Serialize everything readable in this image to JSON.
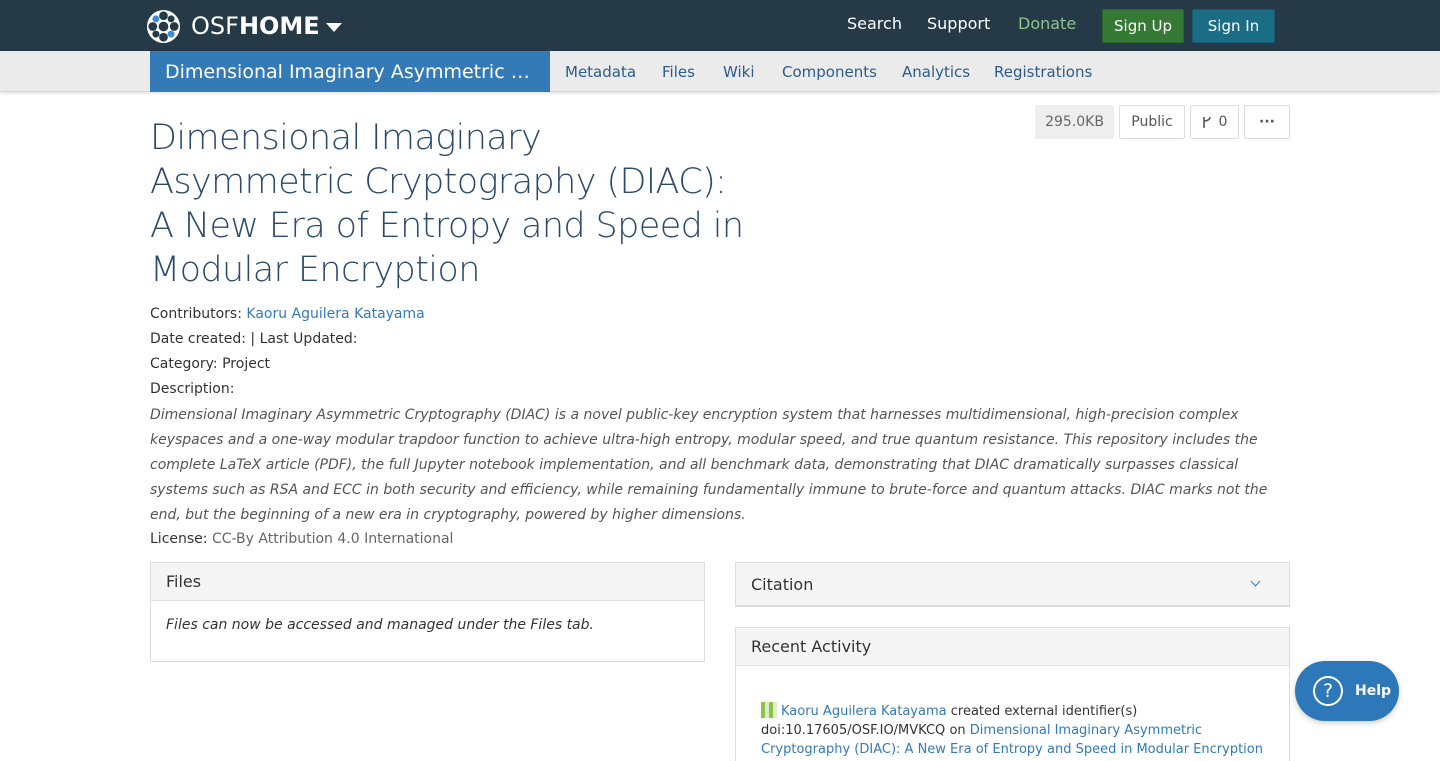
{
  "navbar": {
    "brand_osf": "OSF",
    "brand_home": "HOME",
    "links": {
      "search": "Search",
      "support": "Support",
      "donate": "Donate"
    },
    "signup": "Sign Up",
    "signin": "Sign In"
  },
  "project_nav": {
    "title": "Dimensional Imaginary Asymmetric Cryptography (DIAC): A New Era of Entropy and Speed in Modular Encryption",
    "tabs": [
      "Metadata",
      "Files",
      "Wiki",
      "Components",
      "Analytics",
      "Registrations"
    ]
  },
  "header_buttons": {
    "size": "295.0KB",
    "visibility": "Public",
    "forks": "0",
    "more": "···"
  },
  "project": {
    "title": "Dimensional Imaginary Asymmetric Cryptography (DIAC): A New Era of Entropy and Speed in Modular Encryption",
    "contributors_label": "Contributors:",
    "contributor": "Kaoru Aguilera Katayama",
    "dates_label": "Date created:  | Last Updated:",
    "category_label": "Category:",
    "category": "Project",
    "description_label": "Description:",
    "description": "Dimensional Imaginary Asymmetric Cryptography (DIAC) is a novel public-key encryption system that harnesses multidimensional, high-precision complex keyspaces and a one-way modular trapdoor function to achieve ultra-high entropy, modular speed, and true quantum resistance. This repository includes the complete LaTeX article (PDF), the full Jupyter notebook implementation, and all benchmark data, demonstrating that DIAC dramatically surpasses classical systems such as RSA and ECC in both security and efficiency, while remaining fundamentally immune to brute-force and quantum attacks. DIAC marks not the end, but the beginning of a new era in cryptography, powered by higher dimensions.",
    "license_label": "License:",
    "license": "CC-By Attribution 4.0 International"
  },
  "files_panel": {
    "heading": "Files",
    "body": "Files can now be accessed and managed under the Files tab."
  },
  "citation_panel": {
    "heading": "Citation"
  },
  "activity_panel": {
    "heading": "Recent Activity",
    "entry": {
      "user": "Kaoru Aguilera Katayama",
      "action": "created external identifier(s)",
      "doi": "doi:10.17605/OSF.IO/MVKCQ",
      "on": "on",
      "target": "Dimensional Imaginary Asymmetric Cryptography (DIAC): A New Era of Entropy and Speed in Modular Encryption"
    }
  },
  "help": {
    "label": "Help"
  },
  "colors": {
    "navbar_bg": "#263947",
    "accent_blue": "#337ab7",
    "signup_green": "#357935",
    "signin_teal": "#1b6d85",
    "donate_green": "#88c68c",
    "title_blue": "#2c4b6b"
  }
}
